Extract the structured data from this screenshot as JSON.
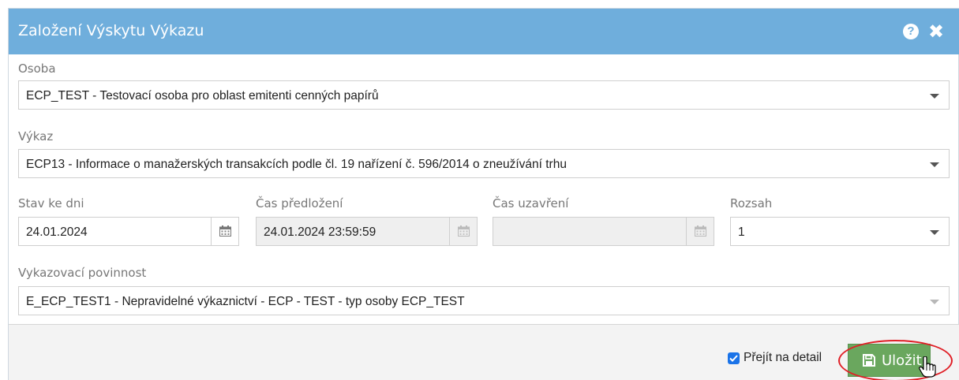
{
  "dialog": {
    "title": "Založení Výskytu Výkazu",
    "help_icon": "question-circle-icon",
    "close_icon": "close-icon",
    "title_bg": "#6faedc"
  },
  "form": {
    "osoba": {
      "label": "Osoba",
      "value": "ECP_TEST - Testovací osoba pro oblast emitenti cenných papírů"
    },
    "vykaz": {
      "label": "Výkaz",
      "value": "ECP13 - Informace o manažerských transakcích podle čl. 19 nařízení č. 596/2014 o zneužívání trhu"
    },
    "stav_ke_dni": {
      "label": "Stav ke dni",
      "value": "24.01.2024",
      "icon": "calendar-icon"
    },
    "cas_predlozeni": {
      "label": "Čas předložení",
      "value": "24.01.2024 23:59:59",
      "icon": "calendar-icon"
    },
    "cas_uzavreni": {
      "label": "Čas uzavření",
      "value": "",
      "icon": "calendar-icon"
    },
    "rozsah": {
      "label": "Rozsah",
      "value": "1"
    },
    "povinnost": {
      "label": "Vykazovací povinnost",
      "value": "E_ECP_TEST1 - Nepravidelné výkaznictví - ECP - TEST - typ osoby ECP_TEST"
    }
  },
  "footer": {
    "checkbox_label": "Přejít na detail",
    "checkbox_checked": true,
    "save_label": "Uložit",
    "save_icon": "floppy-disk-icon",
    "save_color": "#6aa75e",
    "highlight_color": "#e01f26"
  }
}
